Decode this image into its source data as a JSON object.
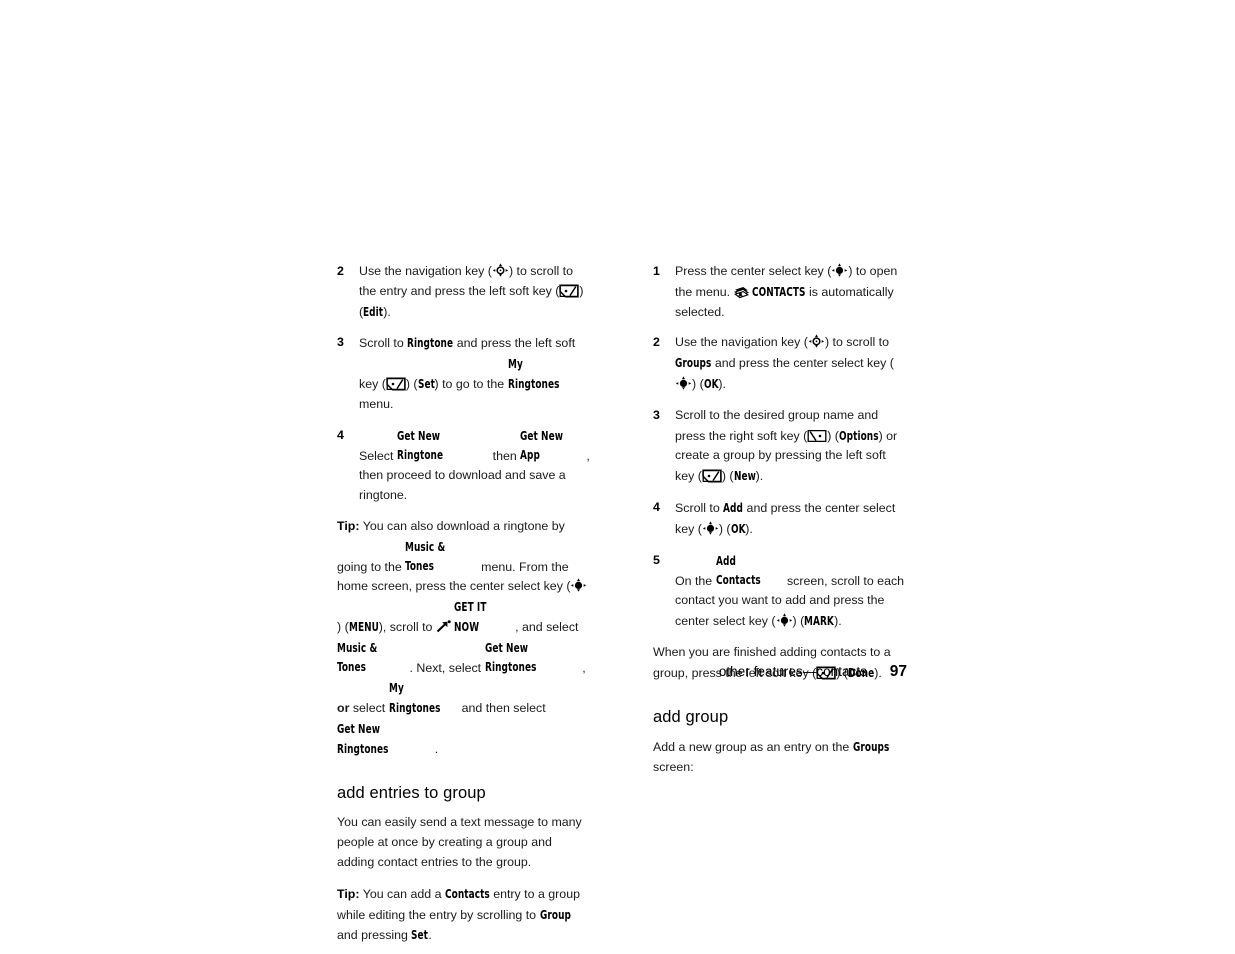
{
  "page": {
    "number": "97",
    "footer_title": "other features—contacts"
  },
  "icons": {
    "nav_key": "navigation-key-icon",
    "center_select_key": "center-select-key-icon",
    "left_soft_key": "left-soft-key-icon",
    "right_soft_key": "right-soft-key-icon",
    "contacts": "contacts-icon",
    "get_it_now": "get-it-now-icon"
  },
  "left_column": {
    "steps": [
      {
        "num": "2",
        "parts": [
          {
            "t": "Use the navigation key (",
            "s": "plain"
          },
          {
            "t": "nav_key",
            "s": "icon"
          },
          {
            "t": ") to scroll to the entry and press the left soft key (",
            "s": "plain"
          },
          {
            "t": "left_soft_key",
            "s": "icon"
          },
          {
            "t": ") (",
            "s": "plain"
          },
          {
            "t": "Edit",
            "s": "ui"
          },
          {
            "t": ").",
            "s": "plain"
          }
        ]
      },
      {
        "num": "3",
        "parts": [
          {
            "t": "Scroll to ",
            "s": "plain"
          },
          {
            "t": "Ringtone",
            "s": "ui"
          },
          {
            "t": " and press the left soft key (",
            "s": "plain"
          },
          {
            "t": "left_soft_key",
            "s": "icon"
          },
          {
            "t": ") (",
            "s": "plain"
          },
          {
            "t": "Set",
            "s": "ui"
          },
          {
            "t": ") to go to the ",
            "s": "plain"
          },
          {
            "t": "My Ringtones",
            "s": "ui"
          },
          {
            "t": " menu.",
            "s": "plain"
          }
        ]
      },
      {
        "num": "4",
        "parts": [
          {
            "t": "Select ",
            "s": "plain"
          },
          {
            "t": "Get New Ringtone",
            "s": "ui"
          },
          {
            "t": " then ",
            "s": "plain"
          },
          {
            "t": "Get New App",
            "s": "ui"
          },
          {
            "t": ", then proceed to download and save a ringtone.",
            "s": "plain"
          }
        ]
      }
    ],
    "tip": {
      "label": "Tip:",
      "parts": [
        {
          "t": " You can also download a ringtone by going to the ",
          "s": "plain"
        },
        {
          "t": "Music & Tones",
          "s": "ui"
        },
        {
          "t": " menu. From the home screen, press the center select key (",
          "s": "plain"
        },
        {
          "t": "center_select_key",
          "s": "icon"
        },
        {
          "t": ") (",
          "s": "plain"
        },
        {
          "t": "MENU",
          "s": "ui"
        },
        {
          "t": "), scroll to ",
          "s": "plain"
        },
        {
          "t": "get_it_now",
          "s": "icon"
        },
        {
          "t": " ",
          "s": "plain"
        },
        {
          "t": "GET IT NOW",
          "s": "ui"
        },
        {
          "t": ", and select ",
          "s": "plain"
        },
        {
          "t": "Music & Tones",
          "s": "ui"
        },
        {
          "t": ". Next, select ",
          "s": "plain"
        },
        {
          "t": "Get New Ringtones",
          "s": "ui"
        },
        {
          "t": ", ",
          "s": "plain"
        },
        {
          "t": "or",
          "s": "bold"
        },
        {
          "t": " select ",
          "s": "plain"
        },
        {
          "t": "My Ringtones",
          "s": "ui"
        },
        {
          "t": " and then select ",
          "s": "plain"
        },
        {
          "t": "Get New Ringtones",
          "s": "ui"
        },
        {
          "t": ".",
          "s": "plain"
        }
      ]
    },
    "heading": "add entries to group",
    "intro": [
      {
        "t": "You can easily send a text message to many people at once by creating a group and adding contact entries to the group.",
        "s": "plain"
      }
    ],
    "tip2": {
      "label": "Tip:",
      "parts": [
        {
          "t": " You can add a ",
          "s": "plain"
        },
        {
          "t": "Contacts",
          "s": "ui"
        },
        {
          "t": " entry to a group while editing the entry by scrolling to ",
          "s": "plain"
        },
        {
          "t": "Group",
          "s": "ui"
        },
        {
          "t": " and pressing ",
          "s": "plain"
        },
        {
          "t": "Set",
          "s": "ui"
        },
        {
          "t": ".",
          "s": "plain"
        }
      ]
    }
  },
  "right_column": {
    "steps": [
      {
        "num": "1",
        "parts": [
          {
            "t": "Press the center select key (",
            "s": "plain"
          },
          {
            "t": "center_select_key",
            "s": "icon"
          },
          {
            "t": ") to open the menu. ",
            "s": "plain"
          },
          {
            "t": "contacts",
            "s": "icon"
          },
          {
            "t": " ",
            "s": "plain"
          },
          {
            "t": "CONTACTS",
            "s": "ui"
          },
          {
            "t": " is automatically selected.",
            "s": "plain"
          }
        ]
      },
      {
        "num": "2",
        "parts": [
          {
            "t": "Use the navigation key (",
            "s": "plain"
          },
          {
            "t": "nav_key",
            "s": "icon"
          },
          {
            "t": ") to scroll to ",
            "s": "plain"
          },
          {
            "t": "Groups",
            "s": "ui"
          },
          {
            "t": " and press the center select key (",
            "s": "plain"
          },
          {
            "t": "center_select_key",
            "s": "icon"
          },
          {
            "t": ") (",
            "s": "plain"
          },
          {
            "t": "OK",
            "s": "ui"
          },
          {
            "t": ").",
            "s": "plain"
          }
        ]
      },
      {
        "num": "3",
        "parts": [
          {
            "t": "Scroll to the desired group name and press the right soft key (",
            "s": "plain"
          },
          {
            "t": "right_soft_key",
            "s": "icon"
          },
          {
            "t": ") (",
            "s": "plain"
          },
          {
            "t": "Options",
            "s": "ui"
          },
          {
            "t": ") or create a group by pressing the left soft key (",
            "s": "plain"
          },
          {
            "t": "left_soft_key",
            "s": "icon"
          },
          {
            "t": ") (",
            "s": "plain"
          },
          {
            "t": "New",
            "s": "ui"
          },
          {
            "t": ").",
            "s": "plain"
          }
        ]
      },
      {
        "num": "4",
        "parts": [
          {
            "t": "Scroll to ",
            "s": "plain"
          },
          {
            "t": "Add",
            "s": "ui"
          },
          {
            "t": " and press the center select key (",
            "s": "plain"
          },
          {
            "t": "center_select_key",
            "s": "icon"
          },
          {
            "t": ") (",
            "s": "plain"
          },
          {
            "t": "OK",
            "s": "ui"
          },
          {
            "t": ").",
            "s": "plain"
          }
        ]
      },
      {
        "num": "5",
        "parts": [
          {
            "t": "On the ",
            "s": "plain"
          },
          {
            "t": "Add Contacts",
            "s": "ui"
          },
          {
            "t": " screen, scroll to each contact you want to add and press the center select key (",
            "s": "plain"
          },
          {
            "t": "center_select_key",
            "s": "icon"
          },
          {
            "t": ") (",
            "s": "plain"
          },
          {
            "t": "MARK",
            "s": "ui"
          },
          {
            "t": ").",
            "s": "plain"
          }
        ]
      }
    ],
    "closing": [
      {
        "t": "When you are finished adding contacts to a group, press the left soft key (",
        "s": "plain"
      },
      {
        "t": "left_soft_key",
        "s": "icon"
      },
      {
        "t": ") (",
        "s": "plain"
      },
      {
        "t": "Done",
        "s": "ui"
      },
      {
        "t": ").",
        "s": "plain"
      }
    ],
    "heading": "add group",
    "intro": [
      {
        "t": "Add a new group as an entry on the ",
        "s": "plain"
      },
      {
        "t": "Groups",
        "s": "ui"
      },
      {
        "t": " screen:",
        "s": "plain"
      }
    ]
  }
}
